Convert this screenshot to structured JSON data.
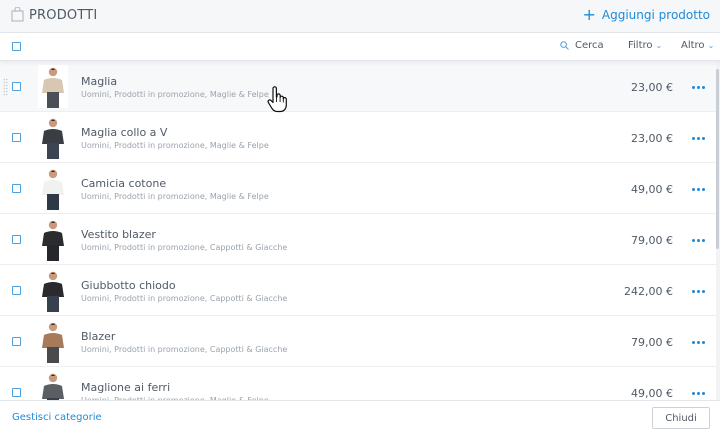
{
  "header": {
    "title": "PRODOTTI",
    "add_label": "Aggiungi prodotto"
  },
  "toolbar": {
    "search_label": "Cerca",
    "filter_label": "Filtro",
    "more_label": "Altro"
  },
  "products": [
    {
      "name": "Maglia",
      "categories": "Uomini, Prodotti in promozione, Maglie & Felpe",
      "price": "23,00 €",
      "top": "#d8c7b2",
      "bottom": "#4b4f57"
    },
    {
      "name": "Maglia collo a V",
      "categories": "Uomini, Prodotti in promozione, Maglie & Felpe",
      "price": "23,00 €",
      "top": "#3a3d42",
      "bottom": "#3d4452"
    },
    {
      "name": "Camicia cotone",
      "categories": "Uomini, Prodotti in promozione, Maglie & Felpe",
      "price": "49,00 €",
      "top": "#f1f1ef",
      "bottom": "#2f3846"
    },
    {
      "name": "Vestito blazer",
      "categories": "Uomini, Prodotti in promozione, Cappotti & Giacche",
      "price": "79,00 €",
      "top": "#2a2c30",
      "bottom": "#25272b"
    },
    {
      "name": "Giubbotto chiodo",
      "categories": "Uomini, Prodotti in promozione, Cappotti & Giacche",
      "price": "242,00 €",
      "top": "#2b2b2d",
      "bottom": "#38404d"
    },
    {
      "name": "Blazer",
      "categories": "Uomini, Prodotti in promozione, Cappotti & Giacche",
      "price": "79,00 €",
      "top": "#a77a5a",
      "bottom": "#4a4a4e"
    },
    {
      "name": "Maglione ai ferri",
      "categories": "Uomini, Prodotti in promozione, Maglie & Felpe",
      "price": "49,00 €",
      "top": "#5b5e63",
      "bottom": "#3c4048"
    }
  ],
  "footer": {
    "manage_label": "Gestisci categorie",
    "close_label": "Chiudi"
  }
}
